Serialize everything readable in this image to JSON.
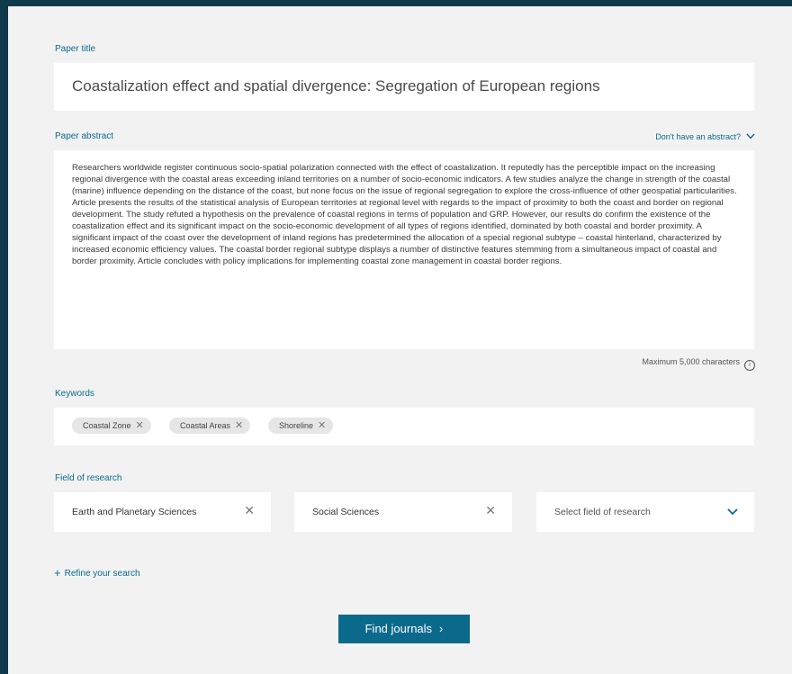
{
  "paper_title": {
    "label": "Paper title",
    "value": "Coastalization effect and spatial divergence: Segregation of European regions"
  },
  "paper_abstract": {
    "label": "Paper abstract",
    "toggle_label": "Don't have an abstract?",
    "value": "Researchers worldwide register continuous socio-spatial polarization connected with the effect of coastalization. It reputedly has the perceptible impact on the increasing regional divergence with the coastal areas exceeding inland territories on a number of socio-economic indicators. A few studies analyze the change in strength of the coastal (marine) influence depending on the distance of the coast, but none focus on the issue of regional segregation to explore the cross-influence of other geospatial particularities. Article presents the results of the statistical analysis of European territories at regional level with regards to the impact of proximity to both the coast and border on regional development. The study refuted a hypothesis on the prevalence of coastal regions in terms of population and GRP. However, our results do confirm the existence of the coastalization effect and its significant impact on the socio-economic development of all types of regions identified, dominated by both coastal and border proximity. A significant impact of the coast over the development of inland regions has predetermined the allocation of a special regional subtype – coastal hinterland, characterized by increased economic efficiency values. The coastal border regional subtype displays a number of distinctive features stemming from a simultaneous impact of coastal and border proximity. Article concludes with policy implications for implementing coastal zone management in coastal border regions.",
    "limit_hint": "Maximum 5,000 characters",
    "info_glyph": "i"
  },
  "keywords": {
    "label": "Keywords",
    "items": [
      "Coastal Zone",
      "Coastal Areas",
      "Shoreline"
    ]
  },
  "field_of_research": {
    "label": "Field of research",
    "selected": [
      "Earth and Planetary Sciences",
      "Social Sciences"
    ],
    "placeholder": "Select field of research"
  },
  "refine": {
    "icon": "+",
    "label": "Refine your search"
  },
  "find_button": {
    "label": "Find journals",
    "arrow": "›"
  },
  "colors": {
    "accent": "#0b6a8c",
    "page_background": "#f2f2f2",
    "frame": "#0f3a4a"
  }
}
